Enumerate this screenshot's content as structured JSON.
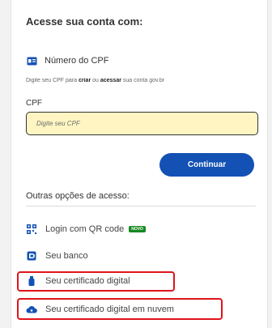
{
  "login": {
    "title": "Acesse sua conta com:",
    "cpf_option": {
      "label": "Número do CPF",
      "icon": "id-card-icon"
    },
    "helper": {
      "part1": "Digite seu CPF para ",
      "bold1": "criar",
      "part2": " ou ",
      "bold2": "acessar",
      "part3": " sua conta gov.br"
    },
    "cpf_field": {
      "label": "CPF",
      "placeholder": "Digite seu CPF",
      "value": ""
    },
    "continue_label": "Continuar"
  },
  "other_options": {
    "title": "Outras opções de acesso:",
    "items": [
      {
        "label": "Login com QR code",
        "icon": "qr-code-icon",
        "badge": "NOVO"
      },
      {
        "label": "Seu banco",
        "icon": "bank-icon"
      },
      {
        "label": "Seu certificado digital",
        "icon": "usb-token-icon"
      },
      {
        "label": "Seu certificado digital em nuvem",
        "icon": "cloud-icon"
      }
    ]
  },
  "colors": {
    "primary": "#1351b4",
    "input_background": "#fff5c2",
    "highlight": "#e0141b",
    "badge": "#168821"
  }
}
